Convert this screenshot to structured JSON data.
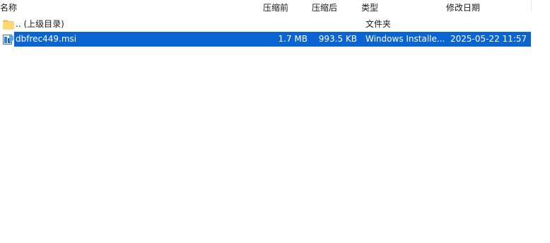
{
  "columns": {
    "name": "名称",
    "packed": "压缩前",
    "compressed": "压缩后",
    "type": "类型",
    "modified": "修改日期"
  },
  "rows": [
    {
      "icon": "folder-icon",
      "name": ".. (上级目录)",
      "packed": "",
      "compressed": "",
      "type": "文件夹",
      "modified": ""
    },
    {
      "icon": "windows-installer-icon",
      "name": "dbfrec449.msi",
      "packed": "1.7 MB",
      "compressed": "993.5 KB",
      "type": "Windows Installe...",
      "modified": "2025-05-22 11:57",
      "selected": true,
      "selection_color": "#0a64d2"
    }
  ]
}
